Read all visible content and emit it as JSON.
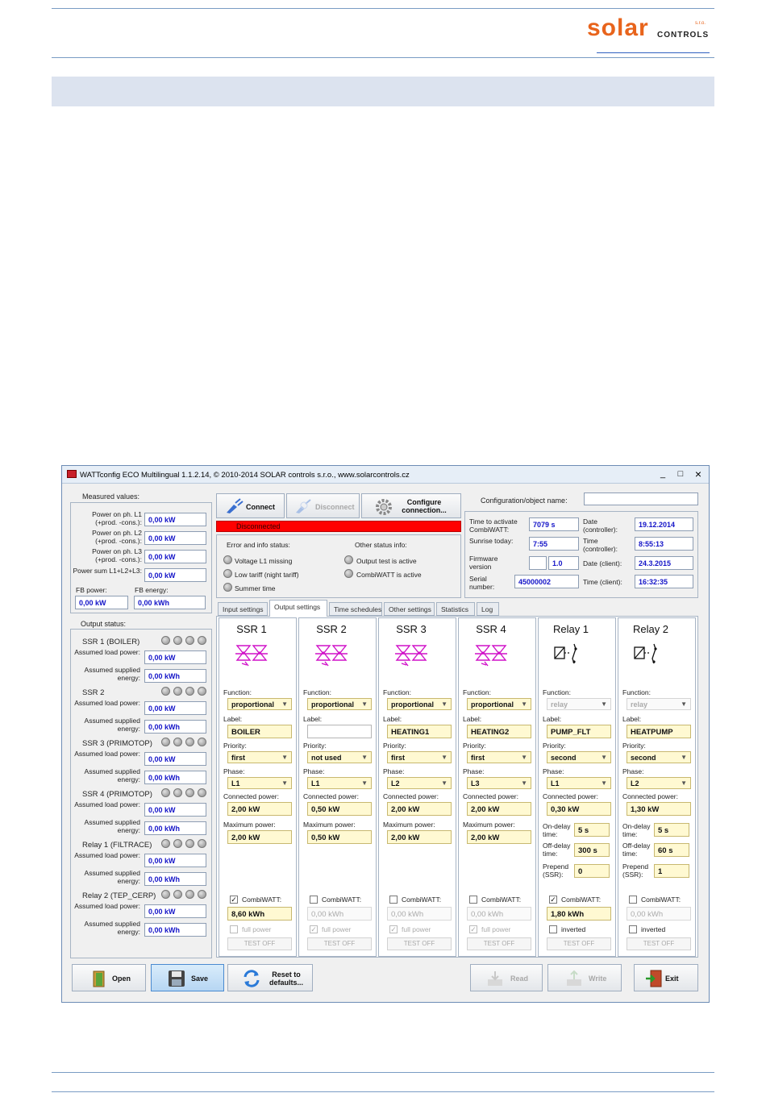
{
  "logo": {
    "brand": "solar",
    "sub": "CONTROLS",
    "sro": "s.r.o."
  },
  "window": {
    "title": "WATTconfig ECO Multilingual 1.1.2.14, © 2010-2014 SOLAR controls s.r.o., www.solarcontrols.cz",
    "controls": {
      "minimize": "_",
      "maximize": "□",
      "close": "×"
    },
    "measured": {
      "heading": "Measured values:",
      "rows": [
        {
          "label": "Power on ph. L1 (+prod. -cons.):",
          "value": "0,00 kW"
        },
        {
          "label": "Power on ph. L2 (+prod. -cons.):",
          "value": "0,00 kW"
        },
        {
          "label": "Power on ph. L3 (+prod. -cons.):",
          "value": "0,00 kW"
        },
        {
          "label": "Power sum L1+L2+L3:",
          "value": "0,00 kW"
        }
      ],
      "fb_power_label": "FB power:",
      "fb_power": "0,00 kW",
      "fb_energy_label": "FB energy:",
      "fb_energy": "0,00 kWh"
    },
    "output_status": {
      "heading": "Output status:",
      "assumed_load_label": "Assumed load power:",
      "assumed_energy_label": "Assumed supplied energy:",
      "items": [
        {
          "name": "SSR 1 (BOILER)",
          "load": "0,00 kW",
          "energy": "0,00 kWh"
        },
        {
          "name": "SSR 2",
          "load": "0,00 kW",
          "energy": "0,00 kWh"
        },
        {
          "name": "SSR 3 (PRIMOTOP)",
          "load": "0,00 kW",
          "energy": "0,00 kWh"
        },
        {
          "name": "SSR 4 (PRIMOTOP)",
          "load": "0,00 kW",
          "energy": "0,00 kWh"
        },
        {
          "name": "Relay 1 (FILTRACE)",
          "load": "0,00 kW",
          "energy": "0,00 kWh"
        },
        {
          "name": "Relay 2 (TEP_CERP)",
          "load": "0,00 kW",
          "energy": "0,00 kWh"
        }
      ]
    },
    "toolbar": {
      "connect": "Connect",
      "disconnect": "Disconnect",
      "configure": "Configure connection...",
      "status": "Disconnected"
    },
    "error_status": {
      "heading": "Error and info status:",
      "items": [
        "Voltage L1 missing",
        "Low tariff (night tariff)",
        "Summer time"
      ]
    },
    "other_status": {
      "heading": "Other status info:",
      "items": [
        "Output test is active",
        "CombiWATT is active"
      ]
    },
    "config": {
      "label": "Configuration/object name:",
      "value": "",
      "time_activate_label": "Time to activate CombiWATT:",
      "time_activate": "7079 s",
      "sunrise_label": "Sunrise today:",
      "sunrise": "7:55",
      "firmware_label": "Firmware version",
      "firmware": "1.0",
      "serial_label": "Serial number:",
      "serial": "45000002",
      "date_ctrl_label": "Date (controller):",
      "date_ctrl": "19.12.2014",
      "time_ctrl_label": "Time (controller):",
      "time_ctrl": "8:55:13",
      "date_client_label": "Date (client):",
      "date_client": "24.3.2015",
      "time_client_label": "Time (client):",
      "time_client": "16:32:35"
    },
    "tabs": [
      "Input settings",
      "Output settings",
      "Time schedules",
      "Other settings",
      "Statistics",
      "Log"
    ],
    "labels": {
      "function": "Function:",
      "label": "Label:",
      "priority": "Priority:",
      "phase": "Phase:",
      "connected": "Connected power:",
      "maximum": "Maximum power:",
      "ondelay": "On-delay time:",
      "offdelay": "Off-delay time:",
      "prepend": "Prepend (SSR):",
      "combiwatt": "CombiWATT:",
      "full_power": "full power",
      "inverted": "inverted",
      "test_off": "TEST OFF"
    },
    "outputs": [
      {
        "name": "SSR 1",
        "function": "proportional",
        "label": "BOILER",
        "priority": "first",
        "phase": "L1",
        "connected": "2,00 kW",
        "maximum": "2,00 kW",
        "combiwatt_checked": "✓",
        "combiwatt_value": "8,60 kWh",
        "opt": ""
      },
      {
        "name": "SSR 2",
        "function": "proportional",
        "label": "",
        "priority": "not used",
        "phase": "L1",
        "connected": "0,50 kW",
        "maximum": "0,50 kW",
        "combiwatt_checked": "",
        "combiwatt_value": "0,00 kWh",
        "opt": "✓"
      },
      {
        "name": "SSR 3",
        "function": "proportional",
        "label": "HEATING1",
        "priority": "first",
        "phase": "L2",
        "connected": "2,00 kW",
        "maximum": "2,00 kW",
        "combiwatt_checked": "",
        "combiwatt_value": "0,00 kWh",
        "opt": "✓"
      },
      {
        "name": "SSR 4",
        "function": "proportional",
        "label": "HEATING2",
        "priority": "first",
        "phase": "L3",
        "connected": "2,00 kW",
        "maximum": "2,00 kW",
        "combiwatt_checked": "",
        "combiwatt_value": "0,00 kWh",
        "opt": "✓"
      },
      {
        "name": "Relay 1",
        "function": "relay",
        "label": "PUMP_FLT",
        "priority": "second",
        "phase": "L1",
        "connected": "0,30 kW",
        "ondelay": "5 s",
        "offdelay": "300 s",
        "prepend": "0",
        "combiwatt_checked": "✓",
        "combiwatt_value": "1,80 kWh",
        "opt": ""
      },
      {
        "name": "Relay 2",
        "function": "relay",
        "label": "HEATPUMP",
        "priority": "second",
        "phase": "L2",
        "connected": "1,30 kW",
        "ondelay": "5 s",
        "offdelay": "60 s",
        "prepend": "1",
        "combiwatt_checked": "",
        "combiwatt_value": "0,00 kWh",
        "opt": ""
      }
    ],
    "bottom": {
      "open": "Open",
      "save": "Save",
      "reset": "Reset to defaults...",
      "read": "Read",
      "write": "Write",
      "exit": "Exit"
    }
  }
}
